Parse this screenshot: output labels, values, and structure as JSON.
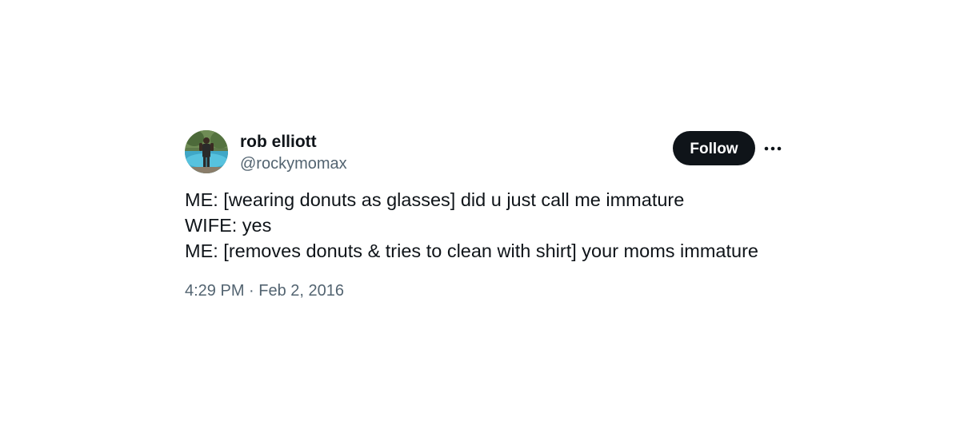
{
  "author": {
    "display_name": "rob elliott",
    "handle": "@rockymomax",
    "avatar_icon": "profile-photo"
  },
  "actions": {
    "follow_label": "Follow",
    "more_icon": "more-horizontal-icon"
  },
  "tweet": {
    "lines": [
      "ME: [wearing donuts as glasses] did u just call me immature",
      "WIFE: yes",
      "ME: [removes donuts & tries to clean with shirt] your moms immature"
    ]
  },
  "meta": {
    "time": "4:29 PM",
    "separator": " · ",
    "date": "Feb 2, 2016"
  },
  "colors": {
    "text_primary": "#0f1419",
    "text_secondary": "#536471",
    "follow_bg": "#0f1419",
    "follow_text": "#ffffff"
  }
}
